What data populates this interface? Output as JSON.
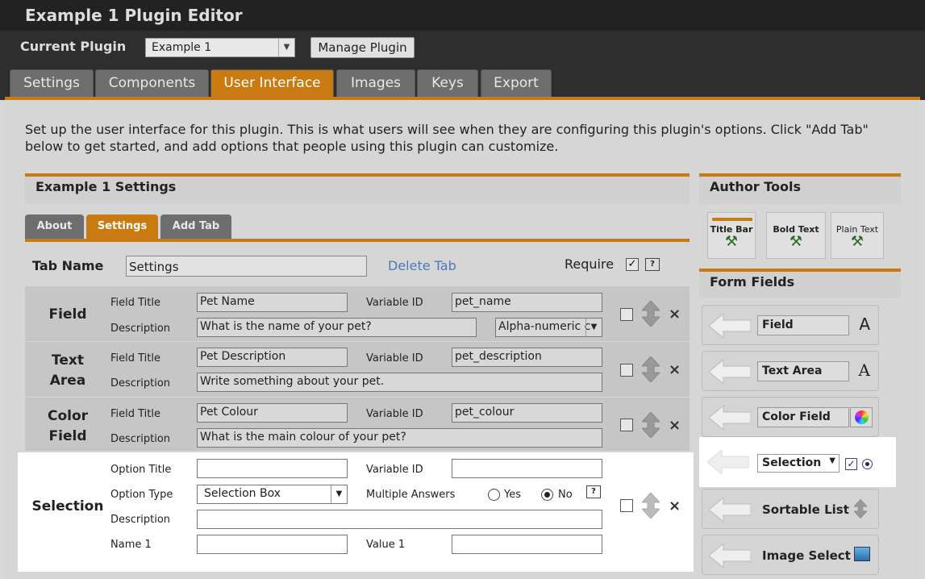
{
  "window": {
    "title": "Example 1 Plugin Editor"
  },
  "plugin_bar": {
    "label": "Current Plugin",
    "selected": "Example 1",
    "manage_label": "Manage Plugin"
  },
  "main_tabs": [
    {
      "label": "Settings",
      "active": false
    },
    {
      "label": "Components",
      "active": false
    },
    {
      "label": "User Interface",
      "active": true
    },
    {
      "label": "Images",
      "active": false
    },
    {
      "label": "Keys",
      "active": false
    },
    {
      "label": "Export",
      "active": false
    }
  ],
  "intro_text": "Set up the user interface for this plugin. This is what users will see when they are configuring this plugin's options. Click \"Add Tab\" below to get started, and add options that people using this plugin can customize.",
  "settings_panel": {
    "title": "Example 1 Settings",
    "subtabs": [
      {
        "label": "About",
        "active": false
      },
      {
        "label": "Settings",
        "active": true
      },
      {
        "label": "Add Tab",
        "active": false
      }
    ],
    "tab_name_label": "Tab Name",
    "tab_name_value": "Settings",
    "delete_tab": "Delete Tab",
    "require_label": "Require",
    "help_glyph": "?"
  },
  "fields": [
    {
      "type": "Field",
      "field_title_label": "Field Title",
      "field_title": "Pet Name",
      "variable_id_label": "Variable ID",
      "variable_id": "pet_name",
      "description_label": "Description",
      "description": "What is the name of your pet?",
      "validation": "Alpha-numeric c"
    },
    {
      "type_line1": "Text",
      "type_line2": "Area",
      "field_title_label": "Field Title",
      "field_title": "Pet Description",
      "variable_id_label": "Variable ID",
      "variable_id": "pet_description",
      "description_label": "Description",
      "description": "Write something about your pet."
    },
    {
      "type_line1": "Color",
      "type_line2": "Field",
      "field_title_label": "Field Title",
      "field_title": "Pet Colour",
      "variable_id_label": "Variable ID",
      "variable_id": "pet_colour",
      "description_label": "Description",
      "description": "What is the main colour of your pet?"
    }
  ],
  "selection": {
    "type": "Selection",
    "option_title_label": "Option Title",
    "option_title": "",
    "variable_id_label": "Variable ID",
    "variable_id": "",
    "option_type_label": "Option Type",
    "option_type": "Selection Box",
    "multiple_answers_label": "Multiple Answers",
    "yes_label": "Yes",
    "no_label": "No",
    "selected": "No",
    "description_label": "Description",
    "description": "",
    "name1_label": "Name 1",
    "name1": "",
    "value1_label": "Value 1",
    "value1": ""
  },
  "author_tools": {
    "title": "Author Tools",
    "tools": [
      "Title Bar",
      "Bold Text",
      "Plain Text"
    ]
  },
  "form_fields": {
    "title": "Form Fields",
    "items": [
      {
        "label": "Field",
        "icon": "font-a-icon"
      },
      {
        "label": "Text Area",
        "icon": "font-a-outline-icon"
      },
      {
        "label": "Color Field",
        "icon": "color-wheel-icon"
      },
      {
        "label": "Selection",
        "icon": "checkbox-radio-icon"
      },
      {
        "label": "Sortable List",
        "icon": "updown-arrow-icon"
      },
      {
        "label": "Image Select",
        "icon": "image-icon"
      }
    ]
  },
  "colors": {
    "accent": "#c97a10",
    "link": "#4a7ab8",
    "dark_bar": "#2e2e2e"
  }
}
